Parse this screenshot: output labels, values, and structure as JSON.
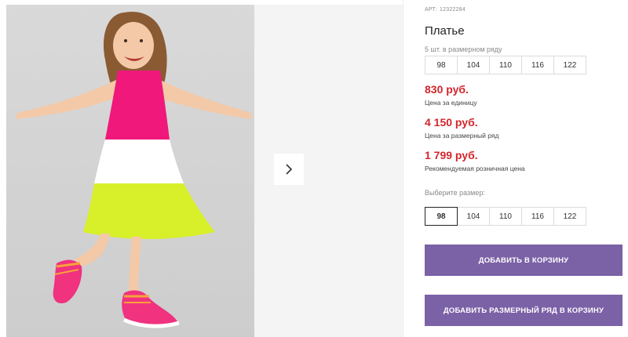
{
  "product": {
    "art_label": "АРТ:",
    "art_number": "12322284",
    "title": "Платье"
  },
  "size_row": {
    "caption": "5 шт. в размерном ряду",
    "sizes": [
      "98",
      "104",
      "110",
      "116",
      "122"
    ]
  },
  "prices": [
    {
      "value": "830 руб.",
      "label": "Цена за единицу"
    },
    {
      "value": "4 150 руб.",
      "label": "Цена за размерный ряд"
    },
    {
      "value": "1 799 руб.",
      "label": "Рекомендуемая розничная цена"
    }
  ],
  "size_picker": {
    "caption": "Выберите размер:",
    "sizes": [
      "98",
      "104",
      "110",
      "116",
      "122"
    ],
    "selected": "98"
  },
  "buttons": {
    "add_to_cart": "ДОБАВИТЬ В КОРЗИНУ",
    "add_row_to_cart": "ДОБАВИТЬ РАЗМЕРНЫЙ РЯД В КОРЗИНУ"
  },
  "gallery": {
    "next_icon": "chevron-right-icon"
  },
  "colors": {
    "price": "#d3262c",
    "button": "#7b61a6",
    "dress_top": "#f0187a",
    "dress_middle": "#ffffff",
    "dress_bottom": "#d8f02a"
  }
}
